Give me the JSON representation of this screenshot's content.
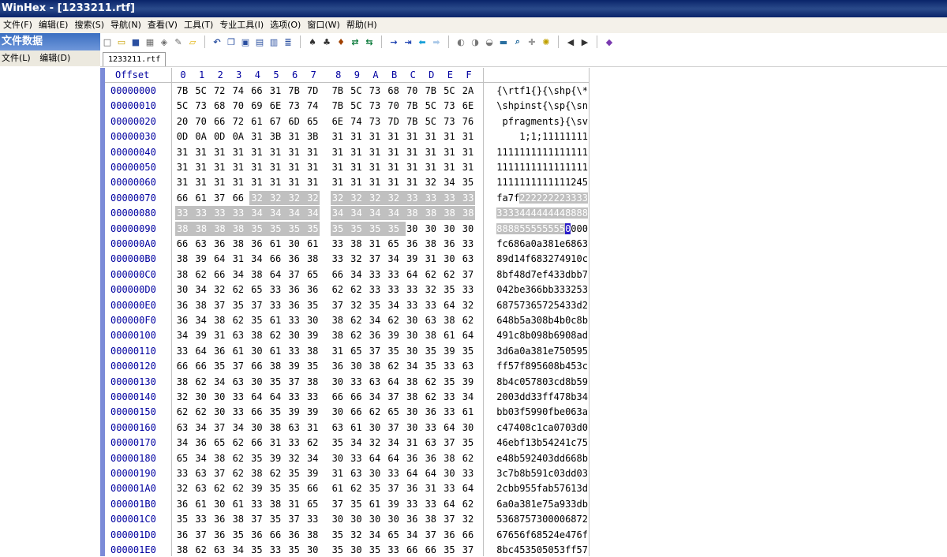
{
  "window": {
    "title": "WinHex - [1233211.rtf]"
  },
  "menubar": [
    "文件(F)",
    "编辑(E)",
    "搜索(S)",
    "导航(N)",
    "查看(V)",
    "工具(T)",
    "专业工具(I)",
    "选项(O)",
    "窗口(W)",
    "帮助(H)"
  ],
  "left_panel": {
    "title": "文件数据",
    "items": [
      "文件(L)",
      "编辑(D)"
    ]
  },
  "toolbar_icons": [
    "new-file-icon",
    "open-icon",
    "save-icon",
    "print-icon",
    "properties-icon",
    "edit-icon",
    "open-folder-icon",
    "sep",
    "undo-icon",
    "copy-icon",
    "copy-block-icon",
    "paste-icon",
    "paste-block-icon",
    "write-icon",
    "sep",
    "find-icon",
    "find-hex-icon",
    "replace-icon",
    "replace-hex-icon",
    "replace-text-icon",
    "sep",
    "goto-icon",
    "goto-offset-icon",
    "back-icon",
    "forward-icon",
    "sep",
    "disk-icon",
    "ram-icon",
    "volume-icon",
    "calculator-icon",
    "zoom-icon",
    "tool-icon",
    "gear-icon",
    "sep",
    "left-arrow-icon",
    "run-icon",
    "sep",
    "book-icon"
  ],
  "tab": {
    "label": "1233211.rtf"
  },
  "hex": {
    "offset_header": "Offset",
    "columns": [
      "0",
      "1",
      "2",
      "3",
      "4",
      "5",
      "6",
      "7",
      "8",
      "9",
      "A",
      "B",
      "C",
      "D",
      "E",
      "F"
    ],
    "rows": [
      {
        "offset": "00000000",
        "bytes": [
          "7B",
          "5C",
          "72",
          "74",
          "66",
          "31",
          "7B",
          "7D",
          "7B",
          "5C",
          "73",
          "68",
          "70",
          "7B",
          "5C",
          "2A"
        ],
        "ascii": "{\\rtf1{}{\\shp{\\*"
      },
      {
        "offset": "00000010",
        "bytes": [
          "5C",
          "73",
          "68",
          "70",
          "69",
          "6E",
          "73",
          "74",
          "7B",
          "5C",
          "73",
          "70",
          "7B",
          "5C",
          "73",
          "6E"
        ],
        "ascii": "\\shpinst{\\sp{\\sn"
      },
      {
        "offset": "00000020",
        "bytes": [
          "20",
          "70",
          "66",
          "72",
          "61",
          "67",
          "6D",
          "65",
          "6E",
          "74",
          "73",
          "7D",
          "7B",
          "5C",
          "73",
          "76"
        ],
        "ascii": " pfragments}{\\sv"
      },
      {
        "offset": "00000030",
        "bytes": [
          "0D",
          "0A",
          "0D",
          "0A",
          "31",
          "3B",
          "31",
          "3B",
          "31",
          "31",
          "31",
          "31",
          "31",
          "31",
          "31",
          "31"
        ],
        "ascii": "1;1;11111111"
      },
      {
        "offset": "00000040",
        "bytes": [
          "31",
          "31",
          "31",
          "31",
          "31",
          "31",
          "31",
          "31",
          "31",
          "31",
          "31",
          "31",
          "31",
          "31",
          "31",
          "31"
        ],
        "ascii": "1111111111111111"
      },
      {
        "offset": "00000050",
        "bytes": [
          "31",
          "31",
          "31",
          "31",
          "31",
          "31",
          "31",
          "31",
          "31",
          "31",
          "31",
          "31",
          "31",
          "31",
          "31",
          "31"
        ],
        "ascii": "1111111111111111"
      },
      {
        "offset": "00000060",
        "bytes": [
          "31",
          "31",
          "31",
          "31",
          "31",
          "31",
          "31",
          "31",
          "31",
          "31",
          "31",
          "31",
          "31",
          "32",
          "34",
          "35"
        ],
        "ascii": "1111111111111245"
      },
      {
        "offset": "00000070",
        "bytes": [
          "66",
          "61",
          "37",
          "66",
          "32",
          "32",
          "32",
          "32",
          "32",
          "32",
          "32",
          "32",
          "33",
          "33",
          "33",
          "33"
        ],
        "ascii": "fa7f222222223333"
      },
      {
        "offset": "00000080",
        "bytes": [
          "33",
          "33",
          "33",
          "33",
          "34",
          "34",
          "34",
          "34",
          "34",
          "34",
          "34",
          "34",
          "38",
          "38",
          "38",
          "38"
        ],
        "ascii": "3333444444448888"
      },
      {
        "offset": "00000090",
        "bytes": [
          "38",
          "38",
          "38",
          "38",
          "35",
          "35",
          "35",
          "35",
          "35",
          "35",
          "35",
          "35",
          "30",
          "30",
          "30",
          "30"
        ],
        "ascii": "8888555555550000"
      },
      {
        "offset": "000000A0",
        "bytes": [
          "66",
          "63",
          "36",
          "38",
          "36",
          "61",
          "30",
          "61",
          "33",
          "38",
          "31",
          "65",
          "36",
          "38",
          "36",
          "33"
        ],
        "ascii": "fc686a0a381e6863"
      },
      {
        "offset": "000000B0",
        "bytes": [
          "38",
          "39",
          "64",
          "31",
          "34",
          "66",
          "36",
          "38",
          "33",
          "32",
          "37",
          "34",
          "39",
          "31",
          "30",
          "63"
        ],
        "ascii": "89d14f683274910c"
      },
      {
        "offset": "000000C0",
        "bytes": [
          "38",
          "62",
          "66",
          "34",
          "38",
          "64",
          "37",
          "65",
          "66",
          "34",
          "33",
          "33",
          "64",
          "62",
          "62",
          "37"
        ],
        "ascii": "8bf48d7ef433dbb7"
      },
      {
        "offset": "000000D0",
        "bytes": [
          "30",
          "34",
          "32",
          "62",
          "65",
          "33",
          "36",
          "36",
          "62",
          "62",
          "33",
          "33",
          "33",
          "32",
          "35",
          "33"
        ],
        "ascii": "042be366bb333253"
      },
      {
        "offset": "000000E0",
        "bytes": [
          "36",
          "38",
          "37",
          "35",
          "37",
          "33",
          "36",
          "35",
          "37",
          "32",
          "35",
          "34",
          "33",
          "33",
          "64",
          "32"
        ],
        "ascii": "68757365725433d2"
      },
      {
        "offset": "000000F0",
        "bytes": [
          "36",
          "34",
          "38",
          "62",
          "35",
          "61",
          "33",
          "30",
          "38",
          "62",
          "34",
          "62",
          "30",
          "63",
          "38",
          "62"
        ],
        "ascii": "648b5a308b4b0c8b"
      },
      {
        "offset": "00000100",
        "bytes": [
          "34",
          "39",
          "31",
          "63",
          "38",
          "62",
          "30",
          "39",
          "38",
          "62",
          "36",
          "39",
          "30",
          "38",
          "61",
          "64"
        ],
        "ascii": "491c8b098b6908ad"
      },
      {
        "offset": "00000110",
        "bytes": [
          "33",
          "64",
          "36",
          "61",
          "30",
          "61",
          "33",
          "38",
          "31",
          "65",
          "37",
          "35",
          "30",
          "35",
          "39",
          "35"
        ],
        "ascii": "3d6a0a381e750595"
      },
      {
        "offset": "00000120",
        "bytes": [
          "66",
          "66",
          "35",
          "37",
          "66",
          "38",
          "39",
          "35",
          "36",
          "30",
          "38",
          "62",
          "34",
          "35",
          "33",
          "63"
        ],
        "ascii": "ff57f895608b453c"
      },
      {
        "offset": "00000130",
        "bytes": [
          "38",
          "62",
          "34",
          "63",
          "30",
          "35",
          "37",
          "38",
          "30",
          "33",
          "63",
          "64",
          "38",
          "62",
          "35",
          "39"
        ],
        "ascii": "8b4c057803cd8b59"
      },
      {
        "offset": "00000140",
        "bytes": [
          "32",
          "30",
          "30",
          "33",
          "64",
          "64",
          "33",
          "33",
          "66",
          "66",
          "34",
          "37",
          "38",
          "62",
          "33",
          "34"
        ],
        "ascii": "2003dd33ff478b34"
      },
      {
        "offset": "00000150",
        "bytes": [
          "62",
          "62",
          "30",
          "33",
          "66",
          "35",
          "39",
          "39",
          "30",
          "66",
          "62",
          "65",
          "30",
          "36",
          "33",
          "61"
        ],
        "ascii": "bb03f5990fbe063a"
      },
      {
        "offset": "00000160",
        "bytes": [
          "63",
          "34",
          "37",
          "34",
          "30",
          "38",
          "63",
          "31",
          "63",
          "61",
          "30",
          "37",
          "30",
          "33",
          "64",
          "30"
        ],
        "ascii": "c47408c1ca0703d0"
      },
      {
        "offset": "00000170",
        "bytes": [
          "34",
          "36",
          "65",
          "62",
          "66",
          "31",
          "33",
          "62",
          "35",
          "34",
          "32",
          "34",
          "31",
          "63",
          "37",
          "35"
        ],
        "ascii": "46ebf13b54241c75"
      },
      {
        "offset": "00000180",
        "bytes": [
          "65",
          "34",
          "38",
          "62",
          "35",
          "39",
          "32",
          "34",
          "30",
          "33",
          "64",
          "64",
          "36",
          "36",
          "38",
          "62"
        ],
        "ascii": "e48b592403dd668b"
      },
      {
        "offset": "00000190",
        "bytes": [
          "33",
          "63",
          "37",
          "62",
          "38",
          "62",
          "35",
          "39",
          "31",
          "63",
          "30",
          "33",
          "64",
          "64",
          "30",
          "33"
        ],
        "ascii": "3c7b8b591c03dd03"
      },
      {
        "offset": "000001A0",
        "bytes": [
          "32",
          "63",
          "62",
          "62",
          "39",
          "35",
          "35",
          "66",
          "61",
          "62",
          "35",
          "37",
          "36",
          "31",
          "33",
          "64"
        ],
        "ascii": "2cbb955fab57613d"
      },
      {
        "offset": "000001B0",
        "bytes": [
          "36",
          "61",
          "30",
          "61",
          "33",
          "38",
          "31",
          "65",
          "37",
          "35",
          "61",
          "39",
          "33",
          "33",
          "64",
          "62"
        ],
        "ascii": "6a0a381e75a933db"
      },
      {
        "offset": "000001C0",
        "bytes": [
          "35",
          "33",
          "36",
          "38",
          "37",
          "35",
          "37",
          "33",
          "30",
          "30",
          "30",
          "30",
          "36",
          "38",
          "37",
          "32"
        ],
        "ascii": "5368757300006872"
      },
      {
        "offset": "000001D0",
        "bytes": [
          "36",
          "37",
          "36",
          "35",
          "36",
          "66",
          "36",
          "38",
          "35",
          "32",
          "34",
          "65",
          "34",
          "37",
          "36",
          "66"
        ],
        "ascii": "67656f68524e476f"
      },
      {
        "offset": "000001E0",
        "bytes": [
          "38",
          "62",
          "63",
          "34",
          "35",
          "33",
          "35",
          "30",
          "35",
          "30",
          "35",
          "33",
          "66",
          "66",
          "35",
          "37"
        ],
        "ascii": "8bc453505053ff57"
      }
    ],
    "selection_start": 116,
    "selection_end": 155,
    "cursor": 156,
    "colors": {
      "offset_text": "#0000a0",
      "selection": "#c0c0c0",
      "cursor": "#2a1cc8",
      "gutter": "#7b8bd8"
    }
  }
}
